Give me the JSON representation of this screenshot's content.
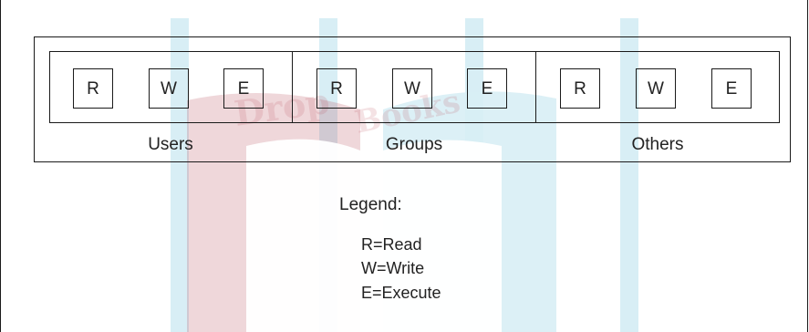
{
  "diagram": {
    "groups": [
      {
        "label": "Users",
        "permissions": [
          "R",
          "W",
          "E"
        ]
      },
      {
        "label": "Groups",
        "permissions": [
          "R",
          "W",
          "E"
        ]
      },
      {
        "label": "Others",
        "permissions": [
          "R",
          "W",
          "E"
        ]
      }
    ]
  },
  "legend": {
    "title": "Legend:",
    "items": [
      "R=Read",
      "W=Write",
      "E=Execute"
    ]
  },
  "colors": {
    "background_light_blue": "#d8eef5",
    "watermark_red": "#b84a56",
    "line": "#1a1a1a",
    "text": "#222222"
  }
}
